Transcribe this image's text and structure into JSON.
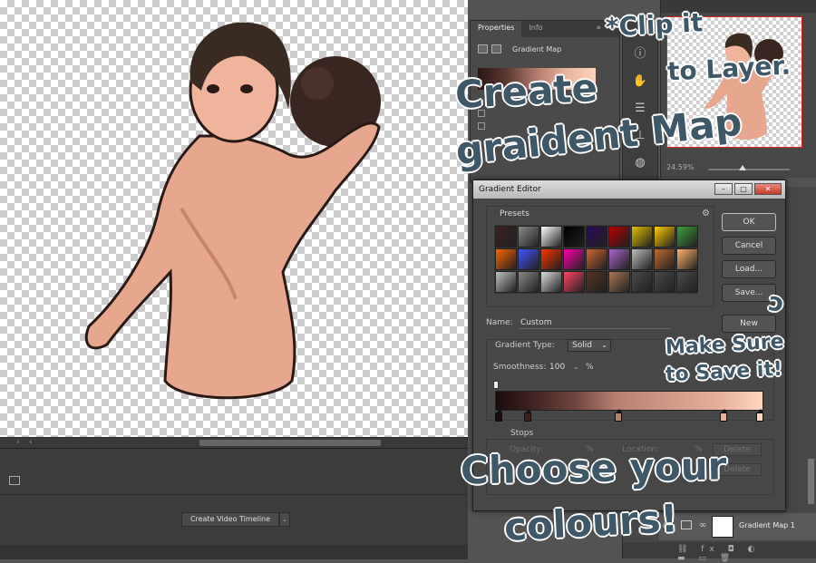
{
  "properties": {
    "tabs": [
      "Properties",
      "Info"
    ],
    "more": "»",
    "layer_type": "Gradient Map"
  },
  "timeline": {
    "create_button": "Create Video Timeline",
    "dropdown": "⌄"
  },
  "navigator": {
    "zoom": "24.59%"
  },
  "layers": {
    "layer_name": "Gradient Map 1",
    "footer_icons": "⛓ fx ◘ ◐ ▬ ▭ 🗑"
  },
  "dialog": {
    "title": "Gradient Editor",
    "presets_label": "Presets",
    "buttons": {
      "ok": "OK",
      "cancel": "Cancel",
      "load": "Load...",
      "save": "Save...",
      "new": "New"
    },
    "name_label": "Name:",
    "name_value": "Custom",
    "gradient_type_label": "Gradient Type:",
    "gradient_type_value": "Solid",
    "smoothness_label": "Smoothness:",
    "smoothness_value": "100",
    "smoothness_unit": "%",
    "stops_label": "Stops",
    "opacity_label": "Opacity:",
    "opacity_unit": "%",
    "location_label": "Location:",
    "location_unit": "%",
    "delete_label": "Delete",
    "presets": [
      "#3b2220",
      "#8a8a8a",
      "#ffffff",
      "#000000",
      "#2b0a55",
      "#b30000",
      "#e0c000",
      "#ffcc00",
      "#3d9f3d",
      "#ff6600",
      "#4455ff",
      "#ff3300",
      "#ff00aa",
      "#cc6633",
      "#aa66cc",
      "#bbbbbb",
      "#c06a30",
      "#ffb36b",
      "#c0c0c0",
      "#888888",
      "#dddddd",
      "#ff4466",
      "#553322",
      "#aa7755",
      "#4a4a4a",
      "#4a4a4a",
      "#4a4a4a"
    ]
  },
  "annotations": {
    "create": "Create",
    "gradient_map": "graident Map",
    "clip_line1": "*Clip it",
    "clip_line2": "to Layer.",
    "save_line1": "Make Sure",
    "save_line2": "to Save it!",
    "choose_line1": "Choose your",
    "choose_line2": "colours!",
    "arrow": "ↄ"
  }
}
